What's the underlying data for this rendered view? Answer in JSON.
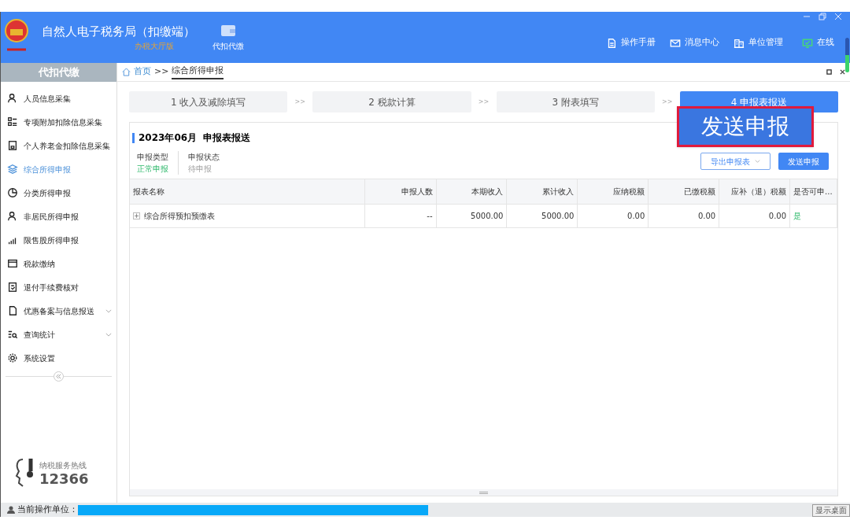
{
  "header": {
    "title": "自然人电子税务局（扣缴端）",
    "edition": "办税大厅版",
    "module": {
      "label": "代扣代缴"
    },
    "actions": [
      {
        "label": "操作手册",
        "kind": "manual"
      },
      {
        "label": "消息中心",
        "kind": "message"
      },
      {
        "label": "单位管理",
        "kind": "unit"
      },
      {
        "label": "在线",
        "kind": "online"
      }
    ]
  },
  "sidebar": {
    "title": "代扣代缴",
    "items": [
      {
        "label": "人员信息采集",
        "kind": "person",
        "selected": false,
        "expandable": false
      },
      {
        "label": "专项附加扣除信息采集",
        "kind": "list",
        "selected": false,
        "expandable": false
      },
      {
        "label": "个人养老金扣除信息采集",
        "kind": "doc",
        "selected": false,
        "expandable": false
      },
      {
        "label": "综合所得申报",
        "kind": "layers",
        "selected": true,
        "expandable": false
      },
      {
        "label": "分类所得申报",
        "kind": "pie",
        "selected": false,
        "expandable": false
      },
      {
        "label": "非居民所得申报",
        "kind": "person",
        "selected": false,
        "expandable": false
      },
      {
        "label": "限售股所得申报",
        "kind": "bars",
        "selected": false,
        "expandable": false
      },
      {
        "label": "税款缴纳",
        "kind": "wallet",
        "selected": false,
        "expandable": false
      },
      {
        "label": "退付手续费核对",
        "kind": "check",
        "selected": false,
        "expandable": false
      },
      {
        "label": "优惠备案与信息报送",
        "kind": "page",
        "selected": false,
        "expandable": true
      },
      {
        "label": "查询统计",
        "kind": "search",
        "selected": false,
        "expandable": true
      },
      {
        "label": "系统设置",
        "kind": "gear",
        "selected": false,
        "expandable": false
      }
    ],
    "hotline": {
      "caption": "纳税服务热线",
      "number": "12366"
    }
  },
  "breadcrumb": {
    "home": "首页",
    "separator": ">>",
    "current": "综合所得申报"
  },
  "steps": [
    {
      "label": "1 收入及减除填写",
      "selected": false
    },
    {
      "label": "2 税款计算",
      "selected": false
    },
    {
      "label": "3 附表填写",
      "selected": false
    },
    {
      "label": "4 申报表报送",
      "selected": true
    }
  ],
  "step_separator": ">>",
  "panel": {
    "title": "2023年06月  申报表报送",
    "fields": [
      {
        "label": "申报类型",
        "value": "正常申报"
      },
      {
        "label": "申报状态",
        "value": "待申报"
      }
    ],
    "buttons": [
      "导出申报表",
      "发送申报"
    ],
    "callout": "发送申报",
    "table": {
      "columns": [
        "报表名称",
        "申报人数",
        "本期收入",
        "累计收入",
        "应纳税额",
        "已缴税额",
        "应补（退）税额",
        "是否可申..."
      ],
      "rows": [
        {
          "expand": "+",
          "cells": [
            "综合所得预扣预缴表",
            "--",
            "5000.00",
            "5000.00",
            "0.00",
            "0.00",
            "0.00",
            "是"
          ]
        }
      ]
    }
  },
  "status_bar": {
    "label": "当前操作单位：",
    "show_desktop": "显示桌面"
  }
}
